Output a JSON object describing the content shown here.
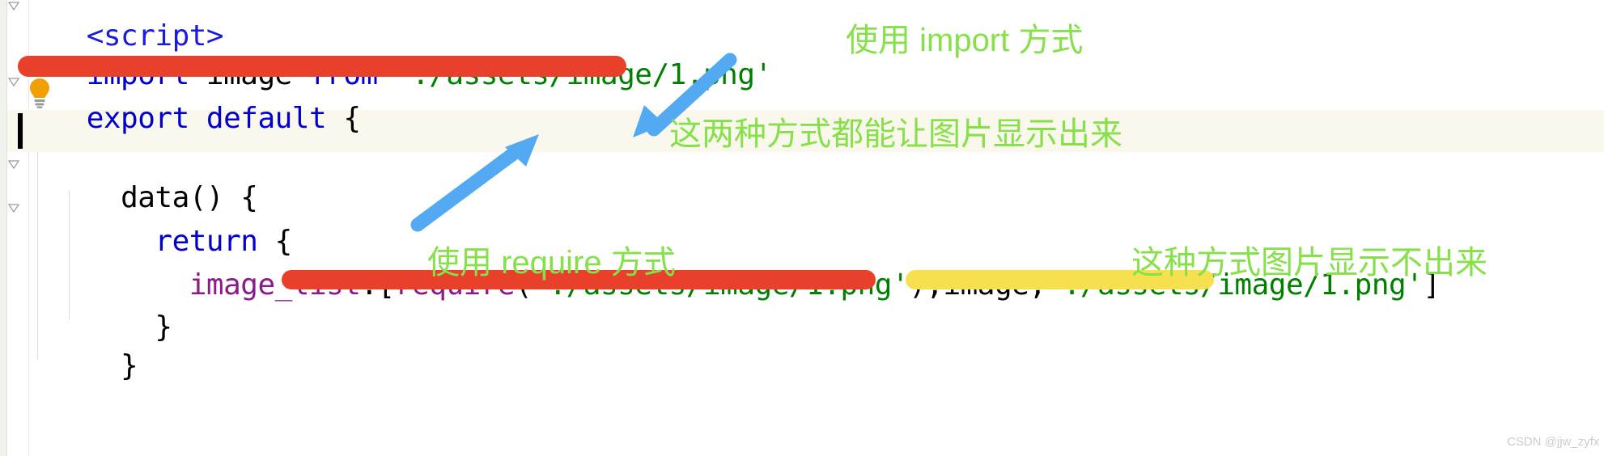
{
  "editor": {
    "theme_background": "#ffffff",
    "gutter_background": "#eef1ec",
    "caret_line_background": "#faf8ed",
    "code_lines": [
      {
        "id": "line-script-tag",
        "tokens": [
          {
            "text": "<script>",
            "kind": "tag"
          }
        ]
      },
      {
        "id": "line-import",
        "tokens": [
          {
            "text": "import",
            "kind": "keyword"
          },
          {
            "text": " image ",
            "kind": "plain"
          },
          {
            "text": "from",
            "kind": "keyword"
          },
          {
            "text": " ",
            "kind": "plain"
          },
          {
            "text": "'./assets/image/1.png'",
            "kind": "string"
          }
        ]
      },
      {
        "id": "line-export-default",
        "tokens": [
          {
            "text": "export default",
            "kind": "keyword"
          },
          {
            "text": " {",
            "kind": "plain"
          }
        ]
      },
      {
        "id": "line-caret-blank",
        "tokens": []
      },
      {
        "id": "line-data-fn",
        "tokens": [
          {
            "text": "  ",
            "kind": "plain"
          },
          {
            "text": "data",
            "kind": "plain"
          },
          {
            "text": "() {",
            "kind": "plain"
          }
        ]
      },
      {
        "id": "line-return",
        "tokens": [
          {
            "text": "    ",
            "kind": "plain"
          },
          {
            "text": "return",
            "kind": "keyword"
          },
          {
            "text": " {",
            "kind": "plain"
          }
        ]
      },
      {
        "id": "line-image-list",
        "tokens": [
          {
            "text": "      ",
            "kind": "plain"
          },
          {
            "text": "image_list",
            "kind": "property"
          },
          {
            "text": ":[",
            "kind": "punctuation"
          },
          {
            "text": "require",
            "kind": "function"
          },
          {
            "text": "(",
            "kind": "punctuation"
          },
          {
            "text": "'./assets/image/1.png'",
            "kind": "string"
          },
          {
            "text": "),",
            "kind": "punctuation"
          },
          {
            "text": "image",
            "kind": "plain"
          },
          {
            "text": ",",
            "kind": "punctuation"
          },
          {
            "text": "'./assets/image/1.png'",
            "kind": "string"
          },
          {
            "text": "]",
            "kind": "punctuation"
          }
        ]
      },
      {
        "id": "line-close-brace-inner",
        "tokens": [
          {
            "text": "    }",
            "kind": "plain"
          }
        ]
      },
      {
        "id": "line-close-brace-outer",
        "tokens": [
          {
            "text": "  }",
            "kind": "plain"
          }
        ]
      }
    ]
  },
  "annotations": {
    "color": "#86e04a",
    "texts": [
      {
        "id": "annot-import",
        "text": "使用 import 方式"
      },
      {
        "id": "annot-both-work",
        "text": "这两种方式都能让图片显示出来"
      },
      {
        "id": "annot-require",
        "text": "使用 require 方式"
      },
      {
        "id": "annot-not-shown",
        "text": "这种方式图片显示不出来"
      }
    ],
    "arrow_color": "#54aaf2",
    "arrows": [
      {
        "id": "arrow-import-to-code",
        "direction": "down-left"
      },
      {
        "id": "arrow-require-to-text",
        "direction": "up-right"
      }
    ]
  },
  "markers": {
    "red_color": "#e8402a",
    "yellow_color": "#f7e04f",
    "strokes": [
      {
        "id": "marker-import-line",
        "color": "#e8402a"
      },
      {
        "id": "marker-require-call",
        "color": "#e8402a"
      },
      {
        "id": "marker-plain-string",
        "color": "#f7e04f"
      }
    ]
  },
  "watermark": {
    "text": "CSDN @jjw_zyfx"
  }
}
